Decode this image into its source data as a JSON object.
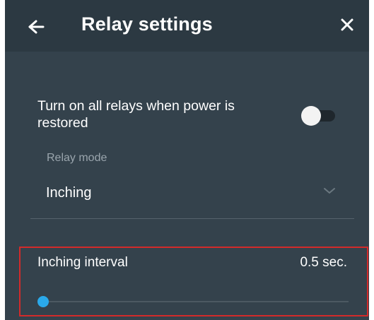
{
  "header": {
    "title": "Relay settings",
    "back_icon": "arrow-left-icon",
    "close_icon": "close-icon"
  },
  "power_restore": {
    "label": "Turn on all relays when power is restored",
    "enabled": false
  },
  "relay_mode": {
    "caption": "Relay mode",
    "value": "Inching",
    "dropdown_icon": "chevron-down-icon"
  },
  "inching_interval": {
    "label": "Inching interval",
    "value": "0.5 sec.",
    "slider_fraction": 0.0
  },
  "colors": {
    "background": "#34424c",
    "header": "#2c3942",
    "accent": "#2aa9ea",
    "highlight": "#d32a2a"
  }
}
